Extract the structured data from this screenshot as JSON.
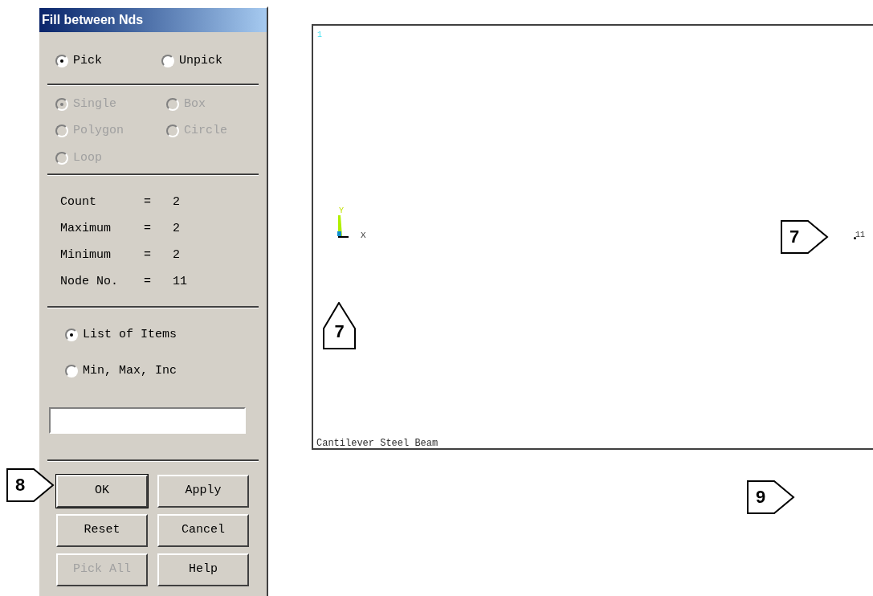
{
  "dialog": {
    "title": "Fill between Nds",
    "mode_options": [
      {
        "label": "Pick",
        "selected": true
      },
      {
        "label": "Unpick",
        "selected": false
      }
    ],
    "shape_options": [
      {
        "label": "Single",
        "selected": true,
        "disabled": true
      },
      {
        "label": "Box",
        "selected": false,
        "disabled": true
      },
      {
        "label": "Polygon",
        "selected": false,
        "disabled": true
      },
      {
        "label": "Circle",
        "selected": false,
        "disabled": true
      },
      {
        "label": "Loop",
        "selected": false,
        "disabled": true
      }
    ],
    "stats": [
      {
        "label": "Count",
        "sign": "=",
        "value": "2"
      },
      {
        "label": "Maximum",
        "sign": "=",
        "value": "2"
      },
      {
        "label": "Minimum",
        "sign": "=",
        "value": "2"
      },
      {
        "label": "Node No.",
        "sign": "=",
        "value": "11"
      }
    ],
    "input_options": [
      {
        "label": "List of Items",
        "selected": true
      },
      {
        "label": "Min, Max, Inc",
        "selected": false
      }
    ],
    "buttons": [
      {
        "label": "OK",
        "default": true,
        "disabled": false
      },
      {
        "label": "Apply",
        "default": false,
        "disabled": false
      },
      {
        "label": "Reset",
        "default": false,
        "disabled": false
      },
      {
        "label": "Cancel",
        "default": false,
        "disabled": false
      },
      {
        "label": "Pick All",
        "default": false,
        "disabled": true
      },
      {
        "label": "Help",
        "default": false,
        "disabled": false
      }
    ]
  },
  "graphics": {
    "window_number": "1",
    "axis_y": "Y",
    "axis_x": "X",
    "node_label": "11",
    "title": "Cantilever Steel Beam"
  },
  "callouts": [
    {
      "number": "8",
      "kind": "right"
    },
    {
      "number": "7",
      "kind": "up"
    },
    {
      "number": "7",
      "kind": "right"
    },
    {
      "number": "9",
      "kind": "right"
    }
  ]
}
